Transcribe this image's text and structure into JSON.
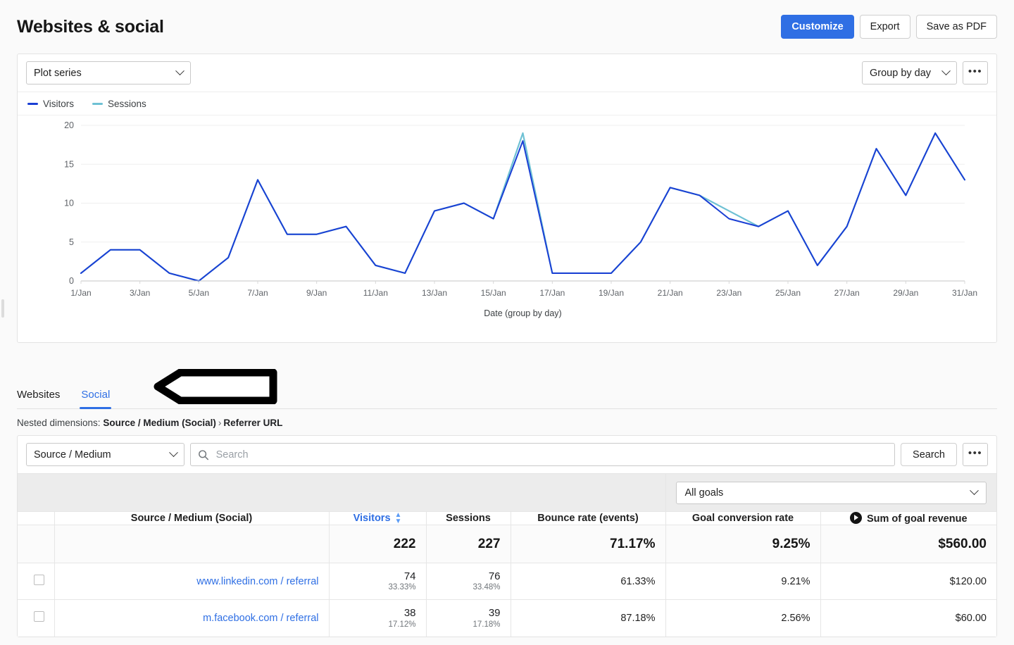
{
  "header": {
    "title": "Websites & social",
    "actions": [
      {
        "label": "Customize",
        "name": "customize-button",
        "primary": true
      },
      {
        "label": "Export",
        "name": "export-button",
        "primary": false
      },
      {
        "label": "Save as PDF",
        "name": "save-as-pdf-button",
        "primary": false
      }
    ]
  },
  "chart_panel": {
    "plot_series_label": "Plot series",
    "group_by_label": "Group by day",
    "more_label": "•••"
  },
  "chart_data": {
    "type": "line",
    "title": "",
    "xlabel": "Date (group by day)",
    "ylabel": "",
    "ylim": [
      0,
      20
    ],
    "yticks": [
      0,
      5,
      10,
      15,
      20
    ],
    "grid": true,
    "legend_position": "top-left",
    "x": [
      "1/Jan",
      "2/Jan",
      "3/Jan",
      "4/Jan",
      "5/Jan",
      "6/Jan",
      "7/Jan",
      "8/Jan",
      "9/Jan",
      "10/Jan",
      "11/Jan",
      "12/Jan",
      "13/Jan",
      "14/Jan",
      "15/Jan",
      "16/Jan",
      "17/Jan",
      "18/Jan",
      "19/Jan",
      "20/Jan",
      "21/Jan",
      "22/Jan",
      "23/Jan",
      "24/Jan",
      "25/Jan",
      "26/Jan",
      "27/Jan",
      "28/Jan",
      "29/Jan",
      "30/Jan",
      "31/Jan"
    ],
    "xtick_labels": [
      "1/Jan",
      "3/Jan",
      "5/Jan",
      "7/Jan",
      "9/Jan",
      "11/Jan",
      "13/Jan",
      "15/Jan",
      "17/Jan",
      "19/Jan",
      "21/Jan",
      "23/Jan",
      "25/Jan",
      "27/Jan",
      "29/Jan",
      "31/Jan"
    ],
    "series": [
      {
        "name": "Visitors",
        "color": "#1a3fd4",
        "values": [
          1,
          4,
          4,
          1,
          0,
          3,
          13,
          6,
          6,
          7,
          2,
          1,
          9,
          10,
          8,
          18,
          1,
          1,
          1,
          5,
          12,
          11,
          8,
          7,
          9,
          2,
          7,
          17,
          11,
          19,
          13
        ]
      },
      {
        "name": "Sessions",
        "color": "#6ec1d4",
        "values": [
          1,
          4,
          4,
          1,
          0,
          3,
          13,
          6,
          6,
          7,
          2,
          1,
          9,
          10,
          8,
          19,
          1,
          1,
          1,
          5,
          12,
          11,
          9,
          7,
          9,
          2,
          7,
          17,
          11,
          19,
          13
        ]
      }
    ]
  },
  "tabs": {
    "items": [
      {
        "label": "Websites",
        "name": "tab-websites",
        "active": false
      },
      {
        "label": "Social",
        "name": "tab-social",
        "active": true
      }
    ]
  },
  "nested_dimensions": {
    "prefix": "Nested dimensions:",
    "first": "Source / Medium (Social)",
    "separator": "›",
    "second": "Referrer URL"
  },
  "table_toolbar": {
    "dimension_label": "Source / Medium",
    "search_placeholder": "Search",
    "search_value": "",
    "search_button_label": "Search",
    "more_label": "•••"
  },
  "goals_filter": {
    "label": "All goals"
  },
  "table": {
    "columns": [
      {
        "label": "",
        "name": "column-checkbox",
        "align": "left"
      },
      {
        "label": "Source / Medium (Social)",
        "name": "column-source-medium",
        "align": "left"
      },
      {
        "label": "Visitors",
        "name": "column-visitors",
        "align": "right",
        "sortable": true
      },
      {
        "label": "Sessions",
        "name": "column-sessions",
        "align": "right"
      },
      {
        "label": "Bounce rate (events)",
        "name": "column-bounce-rate",
        "align": "right"
      },
      {
        "label": "Goal conversion rate",
        "name": "column-goal-conversion-rate",
        "align": "right"
      },
      {
        "label": "Sum of goal revenue",
        "name": "column-sum-of-goal-revenue",
        "align": "right",
        "icon": "goal-play-icon"
      }
    ],
    "totals": {
      "visitors": "222",
      "sessions": "227",
      "bounce_rate": "71.17%",
      "goal_conversion_rate": "9.25%",
      "sum_of_goal_revenue": "$560.00"
    },
    "rows": [
      {
        "source": "www.linkedin.com / referral",
        "visitors": "74",
        "visitors_pct": "33.33%",
        "sessions": "76",
        "sessions_pct": "33.48%",
        "bounce_rate": "61.33%",
        "goal_conversion_rate": "9.21%",
        "sum_of_goal_revenue": "$120.00"
      },
      {
        "source": "m.facebook.com / referral",
        "visitors": "38",
        "visitors_pct": "17.12%",
        "sessions": "39",
        "sessions_pct": "17.18%",
        "bounce_rate": "87.18%",
        "goal_conversion_rate": "2.56%",
        "sum_of_goal_revenue": "$60.00"
      }
    ]
  },
  "annotation": {
    "type": "left-pointing-arrow",
    "target": "Social tab"
  },
  "colors": {
    "accent": "#2f6fe4",
    "visitors_line": "#1a3fd4",
    "sessions_line": "#6ec1d4",
    "page_bg": "#fafafa"
  }
}
